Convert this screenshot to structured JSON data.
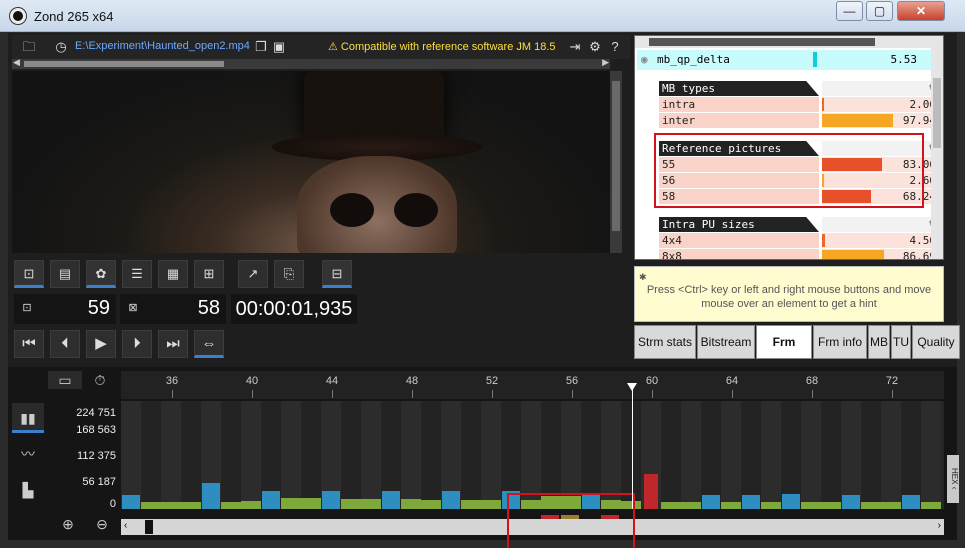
{
  "window": {
    "title": "Zond 265 x64",
    "minimize": "—",
    "maximize": "▢",
    "close": "✕"
  },
  "filebar": {
    "path": "E:\\Experiment\\Haunted_open2.mp4",
    "compat": "⚠ Compatible with reference software JM 18.5"
  },
  "counters": {
    "frame_a": "59",
    "frame_b": "58",
    "time": "00:00:01,935"
  },
  "stats": {
    "qp_label": "mb_qp_delta",
    "qp_value": "5.53",
    "sections": [
      {
        "title": "MB types",
        "pct_label": "%",
        "rows": [
          {
            "label": "intra",
            "value": "2.06",
            "fraction": 0.0206,
            "color": "#e8692c"
          },
          {
            "label": "inter",
            "value": "97.94",
            "fraction": 0.9794,
            "color": "#f6a623"
          }
        ]
      },
      {
        "title": "Reference pictures",
        "pct_label": "%",
        "rows": [
          {
            "label": "55",
            "value": "83.06",
            "fraction": 0.8306,
            "color": "#e8502a"
          },
          {
            "label": "56",
            "value": "2.66",
            "fraction": 0.0266,
            "color": "#f6a623"
          },
          {
            "label": "58",
            "value": "68.24",
            "fraction": 0.6824,
            "color": "#e8502a"
          }
        ]
      },
      {
        "title": "Intra PU sizes",
        "pct_label": "%",
        "rows": [
          {
            "label": "4x4",
            "value": "4.56",
            "fraction": 0.0456,
            "color": "#e8692c"
          },
          {
            "label": "8x8",
            "value": "86.69",
            "fraction": 0.8669,
            "color": "#f6a623"
          }
        ]
      }
    ]
  },
  "hint": "Press <Ctrl> key or left and right mouse buttons and move mouse over an element to get a hint",
  "tabs": [
    {
      "label": "Strm stats",
      "active": false
    },
    {
      "label": "Bitstream",
      "active": false
    },
    {
      "label": "Frm stats",
      "active": true
    },
    {
      "label": "Frm info",
      "active": false
    },
    {
      "label": "MB",
      "active": false
    },
    {
      "label": "TU",
      "active": false
    },
    {
      "label": "Quality",
      "active": false
    }
  ],
  "timeline": {
    "y_labels": [
      "224 751",
      "168 563",
      "112 375",
      "56 187",
      "0"
    ],
    "x_ticks": [
      "36",
      "40",
      "44",
      "48",
      "52",
      "56",
      "60",
      "64",
      "68",
      "72"
    ],
    "hex_label": "HEX ‹",
    "colors": {
      "b_frame": "#7ea83a",
      "p_frame": "#2f8ec0",
      "selected": "#c0272d"
    },
    "frames": [
      {
        "n": 34,
        "type": "p",
        "value": 30000
      },
      {
        "n": 35,
        "type": "b",
        "value": 14000
      },
      {
        "n": 36,
        "type": "b",
        "value": 14000
      },
      {
        "n": 37,
        "type": "b",
        "value": 14000
      },
      {
        "n": 38,
        "type": "p",
        "value": 55000
      },
      {
        "n": 39,
        "type": "b",
        "value": 14000
      },
      {
        "n": 40,
        "type": "b",
        "value": 16000
      },
      {
        "n": 41,
        "type": "p",
        "value": 38000
      },
      {
        "n": 42,
        "type": "b",
        "value": 22000
      },
      {
        "n": 43,
        "type": "b",
        "value": 22000
      },
      {
        "n": 44,
        "type": "p",
        "value": 38000
      },
      {
        "n": 45,
        "type": "b",
        "value": 20000
      },
      {
        "n": 46,
        "type": "b",
        "value": 20000
      },
      {
        "n": 47,
        "type": "p",
        "value": 38000
      },
      {
        "n": 48,
        "type": "b",
        "value": 20000
      },
      {
        "n": 49,
        "type": "b",
        "value": 18000
      },
      {
        "n": 50,
        "type": "p",
        "value": 38000
      },
      {
        "n": 51,
        "type": "b",
        "value": 18000
      },
      {
        "n": 52,
        "type": "b",
        "value": 18000
      },
      {
        "n": 53,
        "type": "p",
        "value": 38000
      },
      {
        "n": 54,
        "type": "b",
        "value": 18000
      },
      {
        "n": 55,
        "type": "b",
        "value": 28000
      },
      {
        "n": 56,
        "type": "b",
        "value": 28000
      },
      {
        "n": 57,
        "type": "p",
        "value": 34000
      },
      {
        "n": 58,
        "type": "b",
        "value": 18000
      },
      {
        "n": 59,
        "type": "b",
        "value": 16000
      },
      {
        "n": 60,
        "type": "sel",
        "value": 72000
      },
      {
        "n": 61,
        "type": "b",
        "value": 14000
      },
      {
        "n": 62,
        "type": "b",
        "value": 14000
      },
      {
        "n": 63,
        "type": "p",
        "value": 30000
      },
      {
        "n": 64,
        "type": "b",
        "value": 14000
      },
      {
        "n": 65,
        "type": "p",
        "value": 30000
      },
      {
        "n": 66,
        "type": "b",
        "value": 14000
      },
      {
        "n": 67,
        "type": "p",
        "value": 32000
      },
      {
        "n": 68,
        "type": "b",
        "value": 14000
      },
      {
        "n": 69,
        "type": "b",
        "value": 14000
      },
      {
        "n": 70,
        "type": "p",
        "value": 30000
      },
      {
        "n": 71,
        "type": "b",
        "value": 14000
      },
      {
        "n": 72,
        "type": "b",
        "value": 14000
      },
      {
        "n": 73,
        "type": "p",
        "value": 30000
      },
      {
        "n": 74,
        "type": "b",
        "value": 14000
      }
    ],
    "max_value": 224751,
    "cursor_frame": 59.5
  }
}
